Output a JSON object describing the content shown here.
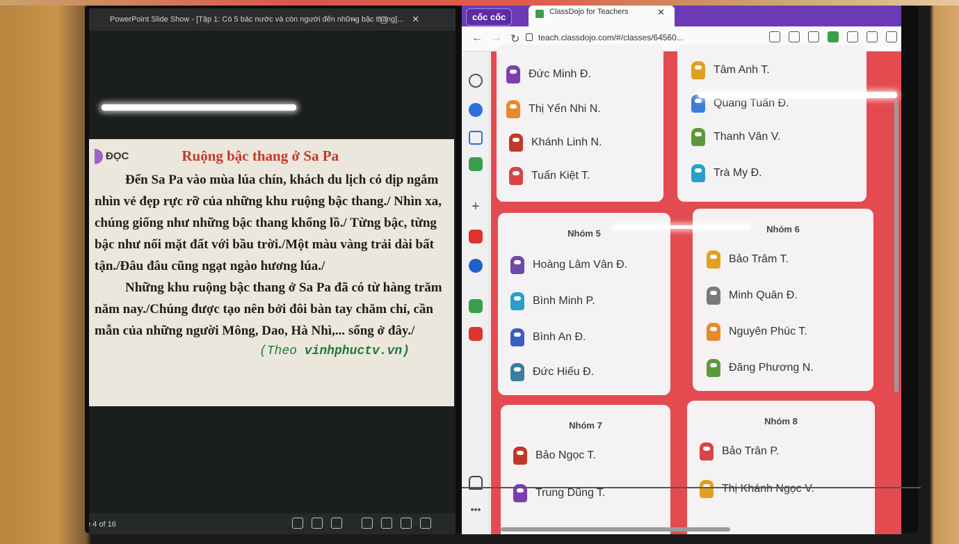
{
  "slideshow": {
    "titlebar": "PowerPoint Slide Show - [Tập 1: Có 5 bác nước và còn người đến những bậc thang]...",
    "doc_tag": "ĐỌC",
    "title": "Ruộng bậc thang ở Sa Pa",
    "paragraph_1": "Đến Sa Pa vào mùa lúa chín, khách du lịch có dịp ngắm nhìn vẻ đẹp rực rỡ của những khu ruộng bậc thang./ Nhìn xa, chúng giống như những bậc thang khổng lồ./ Từng bậc, từng bậc như nối mặt đất với bầu trời./Một màu vàng trải dài bất tận./Đâu đâu cũng ngạt ngào hương lúa./",
    "paragraph_2": "Những khu ruộng bậc thang ở Sa Pa đã có từ hàng trăm năm nay./Chúng được tạo nên bởi đôi bàn tay chăm chỉ, cần mẫn của những người Mông, Dao, Hà Nhì,... sống ở đây./",
    "source_prefix": "(Theo",
    "source_site": "vinhphuctv.vn)",
    "slide_counter": "e 4 of 16"
  },
  "browser": {
    "brand_tab": "cốc cốc",
    "active_tab": "ClassDojo for Teachers",
    "url": "teach.classdojo.com/#/classes/64560...",
    "groups": [
      {
        "name": "",
        "students": [
          "Đức Minh Đ.",
          "Thị Yến Nhi N.",
          "Khánh Linh N.",
          "Tuấn Kiệt T."
        ]
      },
      {
        "name": "",
        "students": [
          "Tâm Anh T.",
          "Quang Tuấn Đ.",
          "Thanh Vân V.",
          "Trà My Đ."
        ]
      },
      {
        "name": "Nhóm 5",
        "students": [
          "Hoàng Lâm Vân Đ.",
          "Bình Minh P.",
          "Bình An Đ.",
          "Đức Hiếu Đ."
        ]
      },
      {
        "name": "Nhóm 6",
        "students": [
          "Bảo Trâm T.",
          "Minh Quân Đ.",
          "Nguyên Phúc T.",
          "Đăng Phương N."
        ]
      },
      {
        "name": "Nhóm 7",
        "students": [
          "Bảo Ngọc T.",
          "Trung Dũng T."
        ]
      },
      {
        "name": "Nhóm 8",
        "students": [
          "Bảo Trân P.",
          "Thị Khánh Ngọc V."
        ]
      }
    ],
    "avatar_colors": [
      "#7b3fb0",
      "#e8892b",
      "#c0392b",
      "#d6454a",
      "#3b7dd8",
      "#2aa0c9",
      "#e0a020",
      "#5a9a3a",
      "#6d4aa8"
    ]
  }
}
